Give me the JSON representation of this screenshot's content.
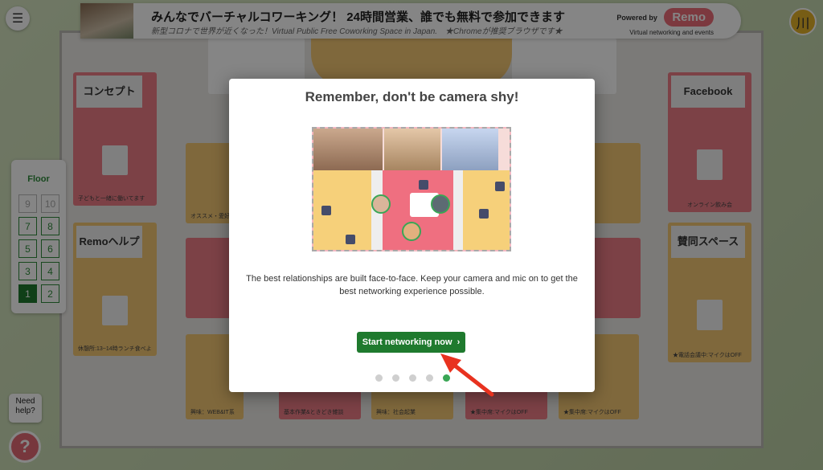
{
  "header": {
    "title": "みんなでバーチャルコワーキング！ 24時間営業、誰でも無料で参加できます",
    "subtitle": "新型コロナで世界が近くなった！Virtual Public Free Coworking Space in Japan.　★Chromeが推奨ブラウザです★",
    "powered_by": "Powered by",
    "brand": "Remo",
    "brand_tagline": "Virtual networking and events"
  },
  "user_avatar": "川",
  "rooms": {
    "concept": "コンセプト",
    "remo_help": "Remoヘルプ",
    "facebook": "Facebook",
    "support_space": "賛同スペース",
    "tags": [
      "子どもと一緒に働いてます",
      "休憩所:13~14時ランチ食べよ",
      "オンライン飲み会",
      "★電話会議中:マイクはOFF",
      "オススメ・愛好",
      "興味：WEB&IT系",
      "基本作業&ときどき雑談",
      "興味：社会起業",
      "★集中席:マイクはOFF",
      "★集中席:マイクはOFF"
    ]
  },
  "floor_panel": {
    "title": "Floor",
    "floors": [
      "9",
      "10",
      "7",
      "8",
      "5",
      "6",
      "3",
      "4",
      "1",
      "2"
    ],
    "active": "1",
    "disabled": [
      "9",
      "10"
    ]
  },
  "help": {
    "label": "Need help?",
    "icon": "question-icon"
  },
  "modal": {
    "title": "Remember, don't be camera shy!",
    "body": "The best relationships are built face-to-face. Keep your camera and mic on to get the best networking experience possible.",
    "cta_label": "Start networking now",
    "cta_icon": "chevron-right-icon",
    "steps": 5,
    "current_step": 5
  },
  "colors": {
    "accent_green": "#1f7a2e",
    "brand_pink": "#ee6d79",
    "annotation_arrow": "#e8321f"
  }
}
